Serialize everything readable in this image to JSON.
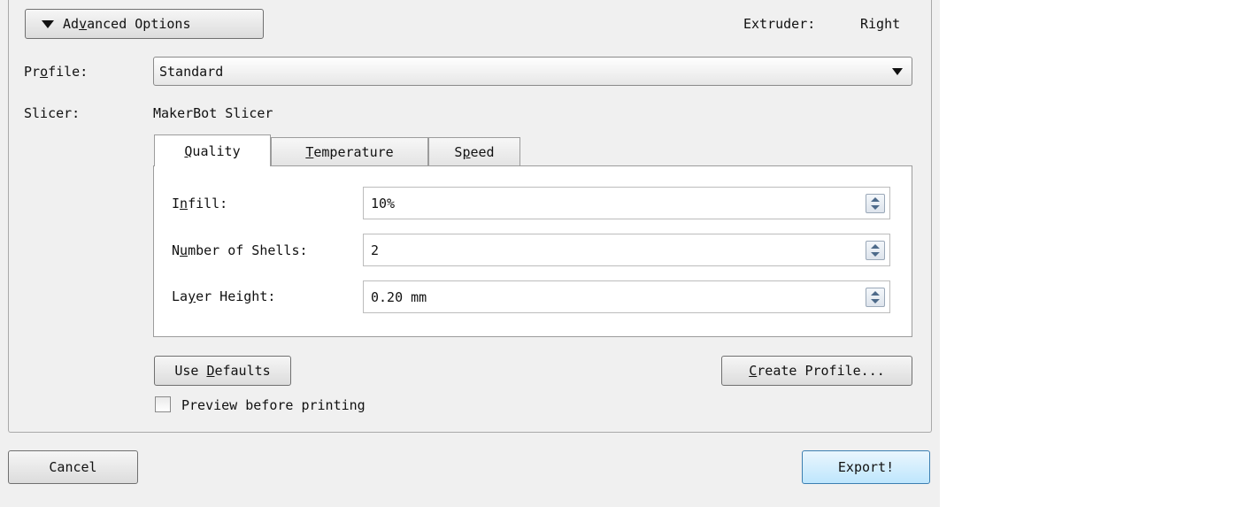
{
  "advanced": {
    "button_pre": "Ad",
    "button_mn": "v",
    "button_post": "anced Options",
    "extruder_label": "Extruder:",
    "extruder_value": "Right"
  },
  "profile": {
    "label_pre": "Pr",
    "label_mn": "o",
    "label_post": "file:",
    "value": "Standard"
  },
  "slicer": {
    "label": "Slicer:",
    "value": "MakerBot Slicer"
  },
  "tabs": [
    {
      "mn": "Q",
      "rest": "uality",
      "active": true
    },
    {
      "mn": "T",
      "rest": "emperature",
      "active": false
    },
    {
      "pre": "S",
      "mn": "p",
      "rest": "eed",
      "active": false
    }
  ],
  "quality": {
    "infill": {
      "label_pre": "I",
      "label_mn": "n",
      "label_post": "fill:",
      "value": "10%"
    },
    "shells": {
      "label_pre": "N",
      "label_mn": "u",
      "label_post": "mber of Shells:",
      "value": "2"
    },
    "layer_height": {
      "label_pre": "La",
      "label_mn": "y",
      "label_post": "er Height:",
      "value": "0.20 mm"
    }
  },
  "buttons": {
    "use_defaults_pre": "Use ",
    "use_defaults_mn": "D",
    "use_defaults_post": "efaults",
    "create_profile_mn": "C",
    "create_profile_post": "reate Profile...",
    "cancel": "Cancel",
    "export": "Export!"
  },
  "preview": {
    "label": "Preview before printing",
    "checked": false
  },
  "icons": [
    "triangle-down-icon",
    "dropdown-arrow-icon",
    "spin-up-icon",
    "spin-down-icon"
  ]
}
